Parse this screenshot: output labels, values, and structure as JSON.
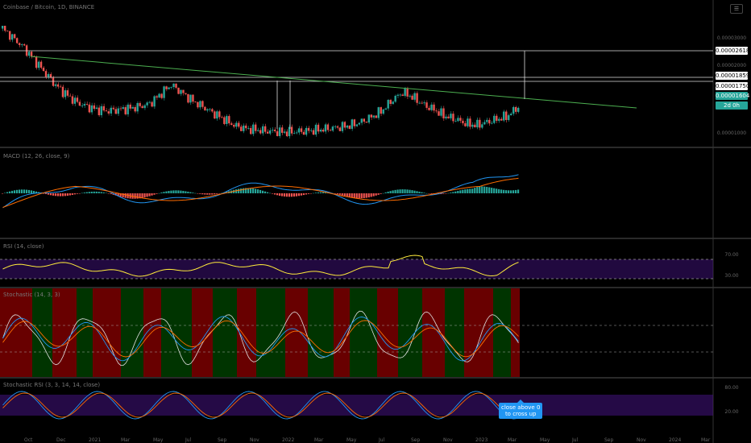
{
  "header": {
    "symbol_line": "Coinbase / Bitcoin, 1D, BINANCE",
    "macd_line": "MACD (12, 26, close, 9)",
    "rsi_line": "RSI (14, close)",
    "stoch_line": "Stochastic (14, 3, 3)",
    "stoch_rsi_line": "Stochastic RSI (3, 3, 14, 14, close)"
  },
  "price_axis": {
    "tags": [
      {
        "label": "0.00002618",
        "style": "white"
      },
      {
        "label": "0.00001859",
        "style": "white"
      },
      {
        "label": "0.00001750",
        "style": "white"
      },
      {
        "label": "0.00001604",
        "style": "green"
      },
      {
        "label": "2d 0h",
        "style": "green"
      }
    ],
    "ticks": [
      "0.00003000",
      "0.00002000",
      "0.00001000"
    ]
  },
  "rsi_levels": [
    "70.00",
    "30.00"
  ],
  "stoch_rsi_levels": [
    "80.00",
    "20.00"
  ],
  "x_axis": [
    "Oct",
    "Dec",
    "2021",
    "Mar",
    "May",
    "Jul",
    "Sep",
    "Nov",
    "2022",
    "Mar",
    "May",
    "Jul",
    "Sep",
    "Nov",
    "2023",
    "Mar",
    "May",
    "Jul",
    "Sep",
    "Nov",
    "2024",
    "Mar"
  ],
  "annotation": {
    "line1": "close above 0",
    "line2": "to cross up"
  },
  "colors": {
    "up": "#26a69a",
    "down": "#ef5350",
    "trendline": "#4caf50",
    "rsi": "#ffeb3b",
    "macd": "#2196f3",
    "signal": "#ff6d00",
    "stoch_k": "#2196f3",
    "stoch_d": "#ff6d00",
    "band": "#4a148c",
    "bg_red": "#7a0000",
    "bg_green": "#003d00"
  },
  "chart_data": {
    "type": "line",
    "series": [
      {
        "values": [
          3e-05,
          2.85e-05,
          2.7e-05,
          2.5e-05,
          2.3e-05,
          2.1e-05,
          1.95e-05,
          1.82e-05,
          1.75e-05,
          1.7e-05,
          1.68e-05,
          1.7e-05,
          1.72e-05,
          1.75e-05,
          1.8e-05,
          1.95e-05,
          2.1e-05,
          1.98e-05,
          1.85e-05,
          1.75e-05,
          1.65e-05,
          1.55e-05,
          1.45e-05,
          1.4e-05,
          1.38e-05,
          1.36e-05,
          1.35e-05,
          1.34e-05,
          1.35e-05,
          1.36e-05,
          1.38e-05,
          1.4e-05,
          1.42e-05,
          1.45e-05,
          1.5e-05,
          1.58e-05,
          1.68e-05,
          1.85e-05,
          1.98e-05,
          1.9e-05,
          1.78e-05,
          1.7e-05,
          1.6e-05,
          1.55e-05,
          1.48e-05,
          1.45e-05,
          1.5e-05,
          1.55e-05,
          1.6e-05,
          1.75e-05
        ]
      }
    ],
    "ylim": [
      1.2e-05,
      3.2e-05
    ]
  }
}
